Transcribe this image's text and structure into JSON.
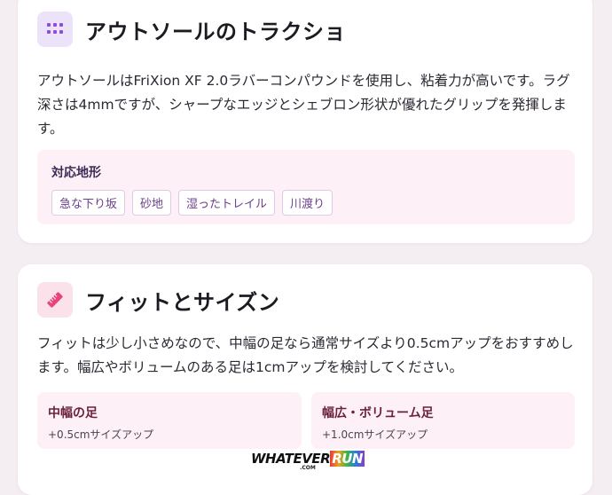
{
  "outsole": {
    "title": "アウトソールのトラクショ",
    "icon": "grid-icon",
    "description": "アウトソールはFriXion XF 2.0ラバーコンパウンドを使用し、粘着力が高いです。ラグ深さは4mmですが、シャープなエッジとシェブロン形状が優れたグリップを発揮します。",
    "terrain_label": "対応地形",
    "terrains": [
      "急な下り坂",
      "砂地",
      "湿ったトレイル",
      "川渡り"
    ]
  },
  "fit": {
    "title": "フィットとサイズン",
    "icon": "ruler-icon",
    "description": "フィットは少し小さめなので、中幅の足なら通常サイズより0.5cmアップをおすすめします。幅広やボリュームのある足は1cmアップを検討してください。",
    "options": [
      {
        "title": "中幅の足",
        "advice": "+0.5cmサイズアップ"
      },
      {
        "title": "幅広・ボリューム足",
        "advice": "+1.0cmサイズアップ"
      }
    ]
  },
  "logo": {
    "main": "WHATEVER",
    "accent": "RUN",
    "sub": ".COM"
  },
  "colors": {
    "accent_purple": "#8a4fd8",
    "accent_pink": "#e8437c",
    "panel_bg": "#fdf0f7"
  }
}
